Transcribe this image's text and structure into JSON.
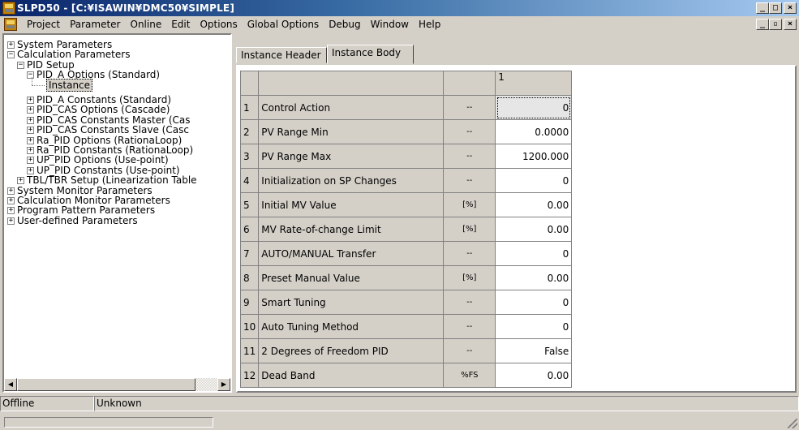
{
  "window": {
    "title": "SLPD50 - [C:¥ISAWIN¥DMC50¥SIMPLE]"
  },
  "menu": [
    "Project",
    "Parameter",
    "Online",
    "Edit",
    "Options",
    "Global Options",
    "Debug",
    "Window",
    "Help"
  ],
  "tree": {
    "items": [
      {
        "label": "System Parameters",
        "level": 0,
        "toggle": "+"
      },
      {
        "label": "Calculation Parameters",
        "level": 0,
        "toggle": "-"
      },
      {
        "label": "PID Setup",
        "level": 1,
        "toggle": "-"
      },
      {
        "label": "PID_A Options (Standard)",
        "level": 2,
        "toggle": "-"
      },
      {
        "label": "Instance",
        "level": 3,
        "toggle": "",
        "selected": true
      },
      {
        "label": "PID_A Constants (Standard)",
        "level": 2,
        "toggle": "+"
      },
      {
        "label": "PID_CAS Options (Cascade)",
        "level": 2,
        "toggle": "+"
      },
      {
        "label": "PID_CAS Constants Master (Cas",
        "level": 2,
        "toggle": "+"
      },
      {
        "label": "PID_CAS Constants Slave (Casc",
        "level": 2,
        "toggle": "+"
      },
      {
        "label": "Ra_PID Options (RationaLoop)",
        "level": 2,
        "toggle": "+"
      },
      {
        "label": "Ra_PID Constants (RationaLoop)",
        "level": 2,
        "toggle": "+"
      },
      {
        "label": "UP_PID Options (Use-point)",
        "level": 2,
        "toggle": "+"
      },
      {
        "label": "UP_PID Constants (Use-point)",
        "level": 2,
        "toggle": "+"
      },
      {
        "label": "TBL/TBR Setup (Linearization Table",
        "level": 1,
        "toggle": "+"
      },
      {
        "label": "System Monitor Parameters",
        "level": 0,
        "toggle": "+"
      },
      {
        "label": "Calculation Monitor Parameters",
        "level": 0,
        "toggle": "+"
      },
      {
        "label": "Program Pattern Parameters",
        "level": 0,
        "toggle": "+"
      },
      {
        "label": "User-defined Parameters",
        "level": 0,
        "toggle": "+"
      }
    ]
  },
  "tabs": [
    {
      "label": "Instance Header",
      "active": false
    },
    {
      "label": "Instance Body",
      "active": true
    }
  ],
  "grid": {
    "column_header": "1",
    "rows": [
      {
        "num": "1",
        "label": "Control Action",
        "unit": "--",
        "value": "0"
      },
      {
        "num": "2",
        "label": "PV Range Min",
        "unit": "--",
        "value": "0.0000"
      },
      {
        "num": "3",
        "label": "PV Range Max",
        "unit": "--",
        "value": "1200.000"
      },
      {
        "num": "4",
        "label": "Initialization on SP Changes",
        "unit": "--",
        "value": "0"
      },
      {
        "num": "5",
        "label": "Initial MV Value",
        "unit": "[%]",
        "value": "0.00"
      },
      {
        "num": "6",
        "label": "MV Rate-of-change Limit",
        "unit": "[%]",
        "value": "0.00"
      },
      {
        "num": "7",
        "label": "AUTO/MANUAL Transfer",
        "unit": "--",
        "value": "0"
      },
      {
        "num": "8",
        "label": "Preset Manual Value",
        "unit": "[%]",
        "value": "0.00"
      },
      {
        "num": "9",
        "label": "Smart Tuning",
        "unit": "--",
        "value": "0"
      },
      {
        "num": "10",
        "label": "Auto Tuning Method",
        "unit": "--",
        "value": "0"
      },
      {
        "num": "11",
        "label": "2 Degrees of Freedom PID",
        "unit": "--",
        "value": "False"
      },
      {
        "num": "12",
        "label": "Dead Band",
        "unit": "%FS",
        "value": "0.00"
      }
    ]
  },
  "status": {
    "connection": "Offline",
    "state": "Unknown"
  }
}
